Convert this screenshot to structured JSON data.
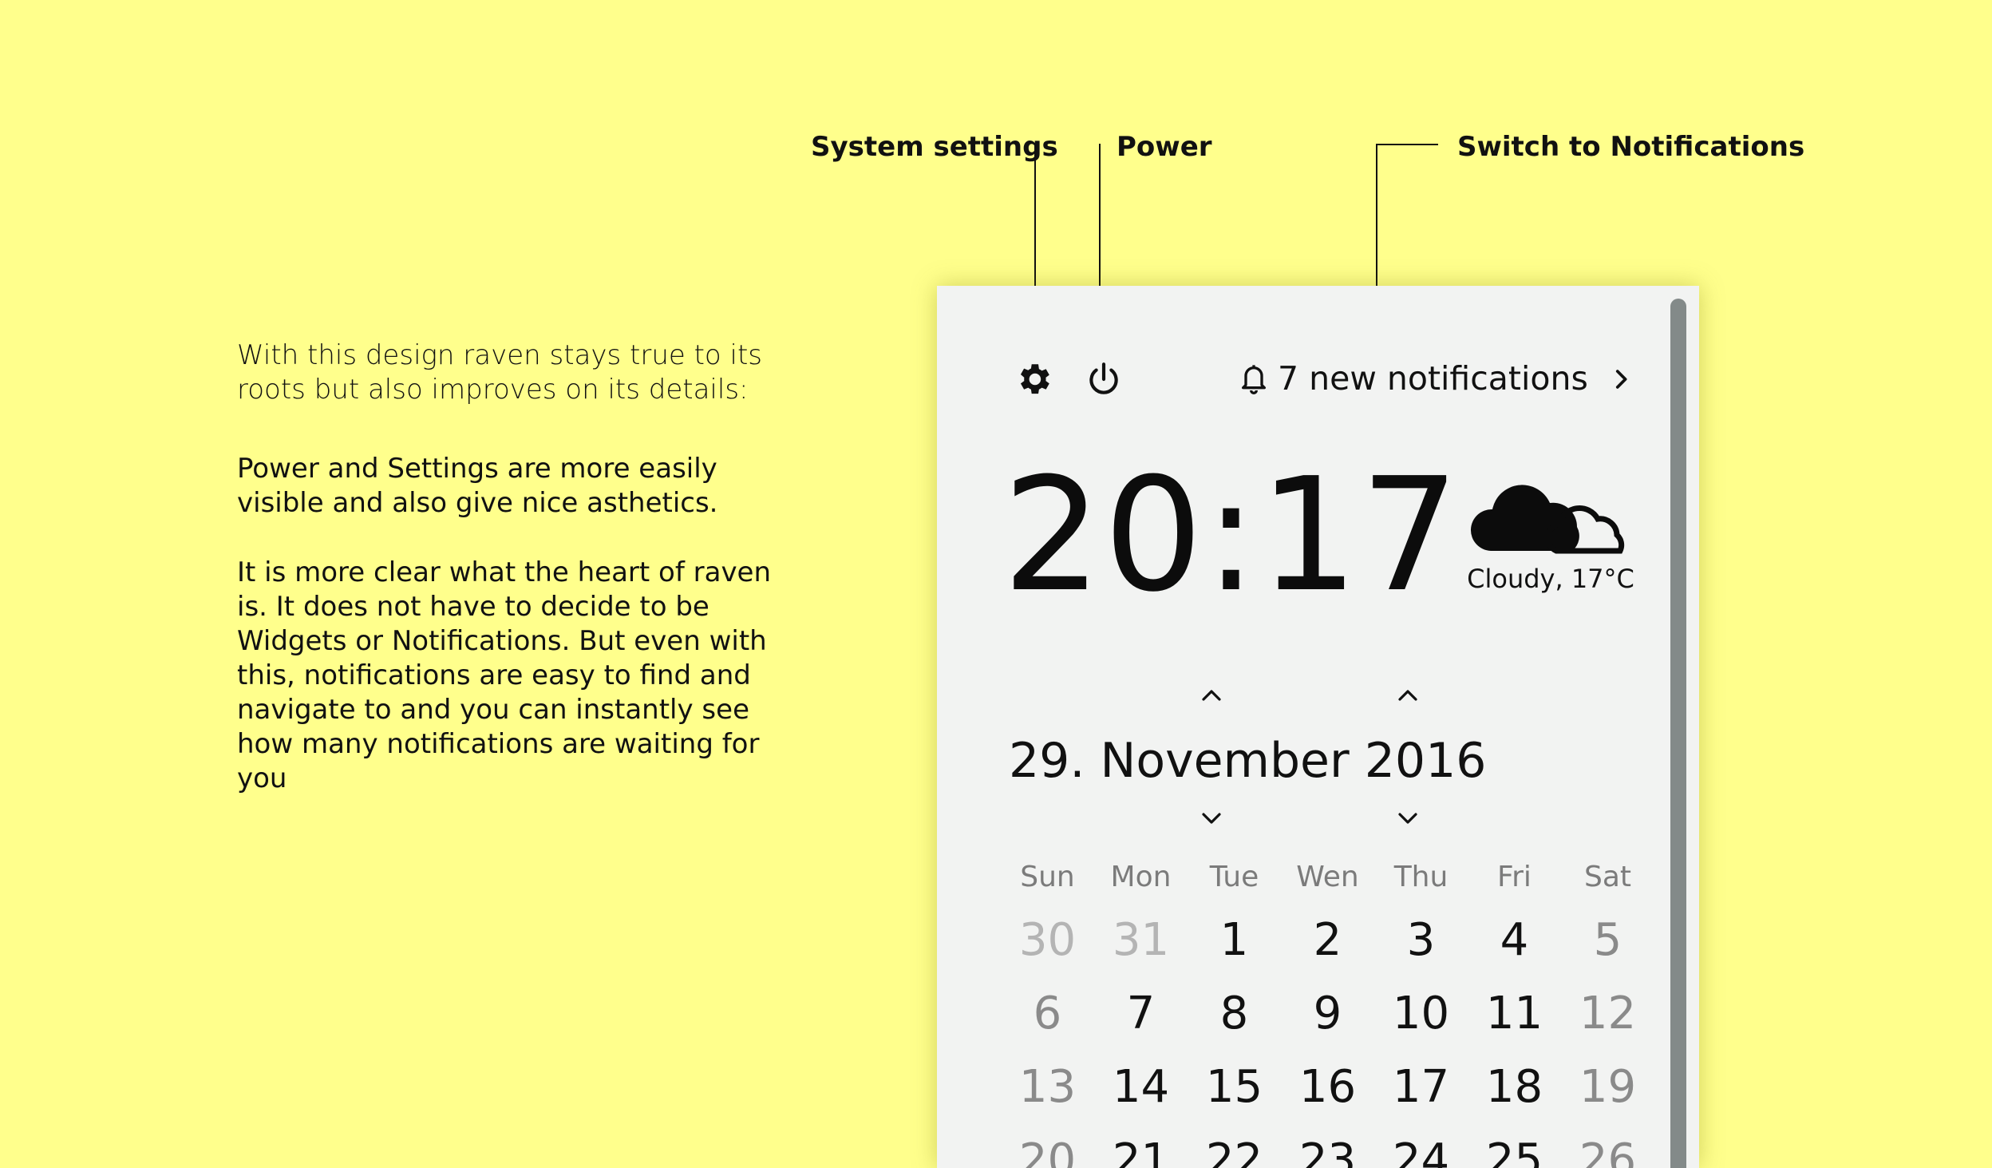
{
  "annotations": {
    "system_settings": "System settings",
    "power": "Power",
    "switch_notifications": "Switch to Notifications"
  },
  "description": {
    "paragraph1": "With this design raven stays true to its\nroots but also improves on its details:",
    "paragraph2": "Power and Settings are more easily\nvisible and also give nice asthetics.",
    "paragraph3": "It is more clear what the heart of raven\nis. It does not have to decide to be\nWidgets or Notifications. But even with\nthis, notifications are easy to find and\nnavigate to and you can instantly see\nhow many notifications are waiting for you"
  },
  "topbar": {
    "settings_icon": "gear-icon",
    "power_icon": "power-icon",
    "notifications_label": "7 new notifications",
    "bell_icon": "bell-icon",
    "chevron_icon": "chevron-right-icon"
  },
  "clock": {
    "time": "20:17"
  },
  "weather": {
    "icon": "cloudy-icon",
    "label": "Cloudy, 17°C"
  },
  "date": {
    "day": "29.",
    "month": "November",
    "year": "2016"
  },
  "calendar": {
    "weekdays": [
      "Sun",
      "Mon",
      "Tue",
      "Wen",
      "Thu",
      "Fri",
      "Sat"
    ],
    "weeks": [
      [
        "30",
        "31",
        "1",
        "2",
        "3",
        "4",
        "5"
      ],
      [
        "6",
        "7",
        "8",
        "9",
        "10",
        "11",
        "12"
      ],
      [
        "13",
        "14",
        "15",
        "16",
        "17",
        "18",
        "19"
      ],
      [
        "20",
        "21",
        "22",
        "23",
        "24",
        "25",
        "26"
      ]
    ]
  },
  "colors": {
    "background": "#ffff8c",
    "panel": "#f2f3f2",
    "scrollbar": "#838a89",
    "text": "#111111",
    "muted": "#8a8a8a",
    "other_month": "#b4b4b4"
  }
}
